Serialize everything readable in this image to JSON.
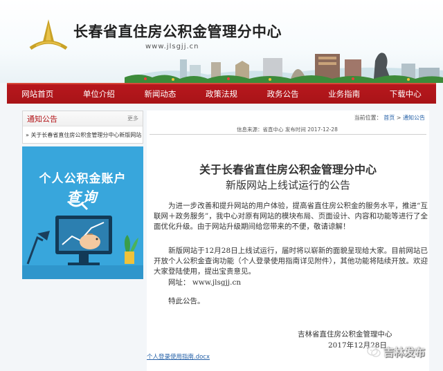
{
  "header": {
    "site_title": "长春省直住房公积金管理分中心",
    "site_url": "www.jlsgjj.cn"
  },
  "nav": {
    "items": [
      "网站首页",
      "单位介绍",
      "新闻动态",
      "政策法规",
      "政务公告",
      "业务指南",
      "下载中心"
    ]
  },
  "sidebar": {
    "notice_title": "通知公告",
    "more_label": "更多",
    "notice_link": "» 关于长春省直住房公积金管理分中心新版网站..."
  },
  "ad": {
    "line1": "个人公积金账户",
    "line2": "查询"
  },
  "breadcrumb": {
    "prefix": "当前位置：",
    "home": "首页",
    "separator": ">",
    "current": "通知公告"
  },
  "article": {
    "meta": "信息来源：省直中心   发布时间 2017-12-28",
    "title_line1": "关于长春省直住房公积金管理分中心",
    "title_line2": "新版网站上线试运行的公告",
    "paragraph1": "为进一步改善和提升网站的用户体验，提高省直住房公积金的服务水平，推进“互联网＋政务服务”，我中心对原有网站的模块布局、页面设计、内容和功能等进行了全面优化升级。由于网站升级期间给您带来的不便，敬请谅解！",
    "paragraph2": "　　新版网站于12月28日上线试运行，届时将以崭新的面貌呈现给大家。目前网站已开放个人公积金查询功能（个人登录使用指南详见附件），其他功能将陆续开放。欢迎大家登陆使用，提出宝贵意见。",
    "url_line": "　　网址： www.jlsgjj.cn",
    "closing": "　　特此公告。",
    "signature_org": "吉林省直住房公积金管理中心",
    "signature_date": "2017年12月28日",
    "attachment": "个人登录使用指南.docx"
  },
  "watermark": {
    "text": "吉林发布"
  },
  "colors": {
    "nav_red": "#b8171d",
    "ad_blue": "#38a6dc",
    "link_blue": "#2460a7"
  }
}
